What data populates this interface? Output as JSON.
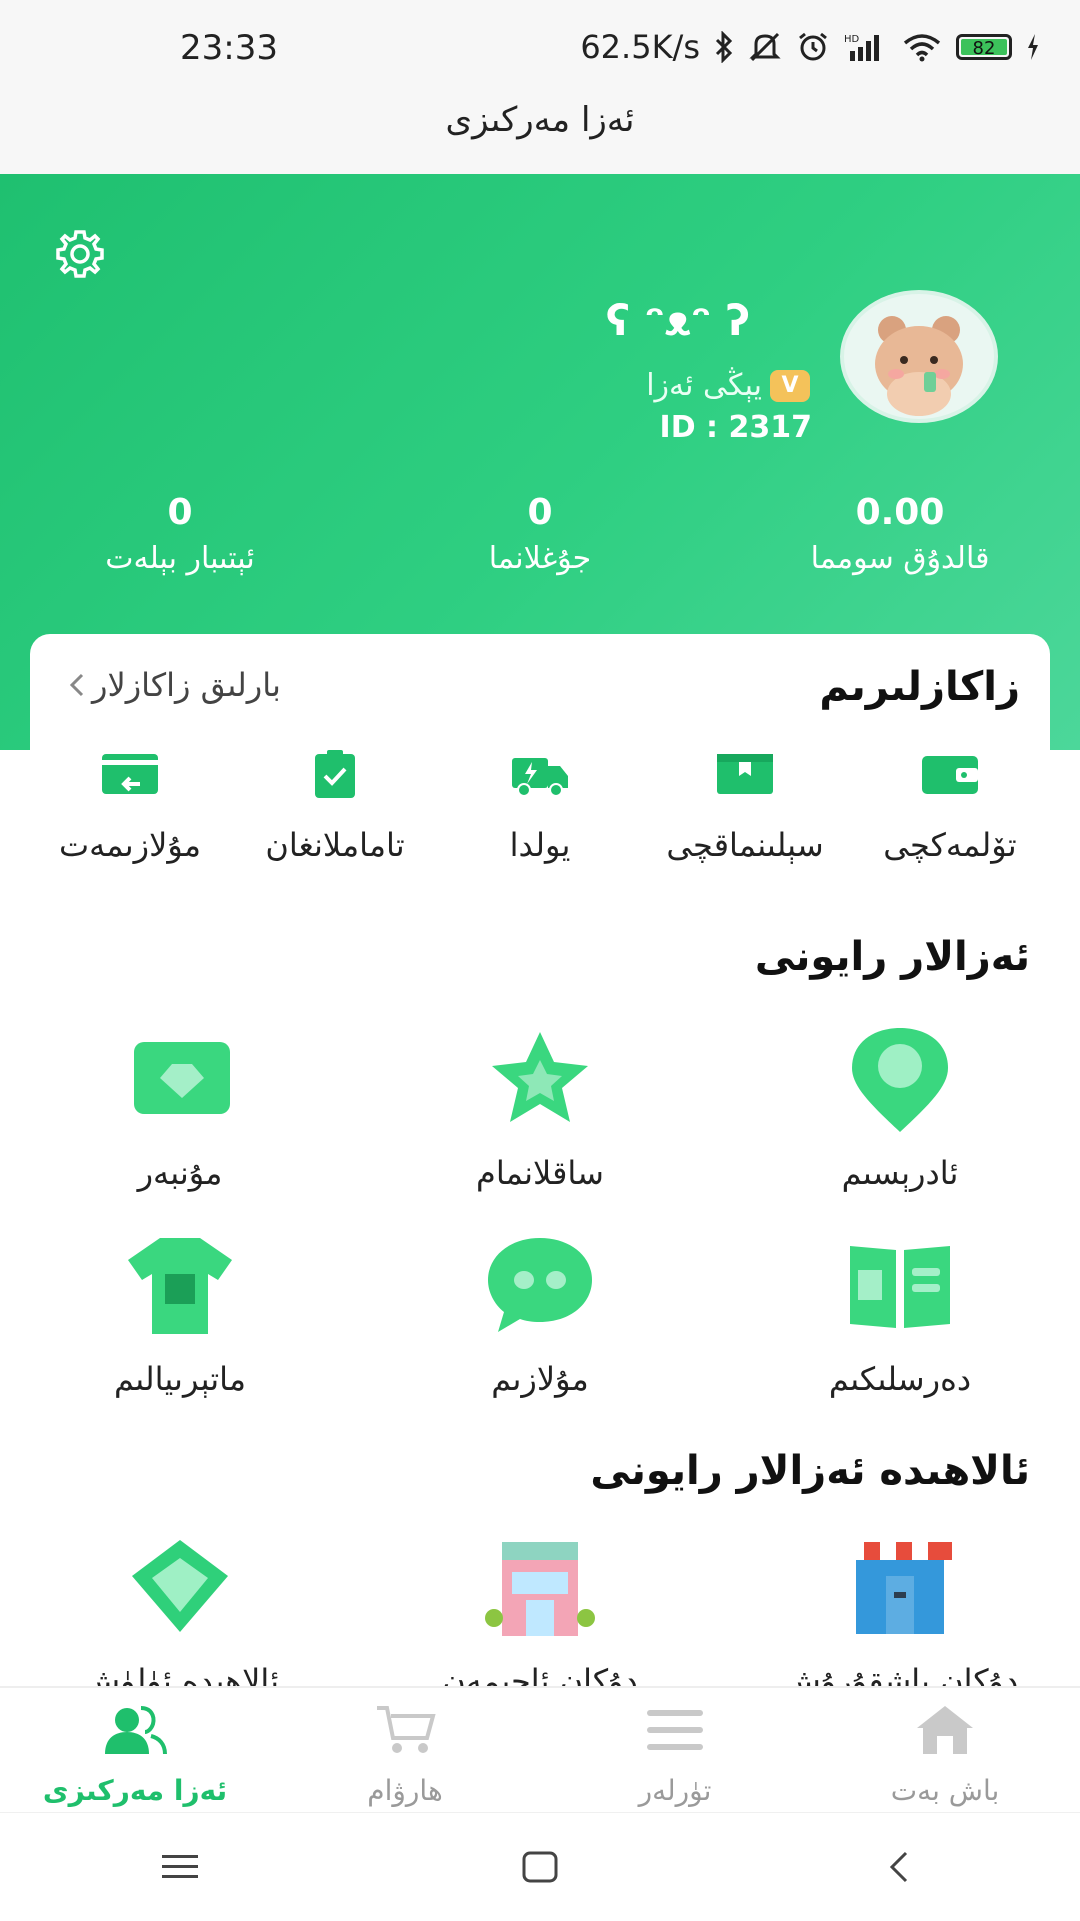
{
  "status_bar": {
    "time": "23:33",
    "network_speed": "62.5K/s",
    "battery": "82",
    "icons": [
      "bluetooth-icon",
      "mute-icon",
      "alarm-icon",
      "hd-signal-icon",
      "wifi-icon",
      "battery-icon",
      "charging-icon"
    ]
  },
  "title_bar": {
    "title": "ئەزا مەركىزى"
  },
  "profile": {
    "nickname": "ʕ ᵔᴥᵔ ʔ",
    "level_label": "يېڭى ئەزا",
    "level_badge": "V",
    "id_text": "ID :  2317"
  },
  "stats": [
    {
      "value": "0.00",
      "label": "قالدۇق سومما"
    },
    {
      "value": "0",
      "label": "جۇغلانما"
    },
    {
      "value": "0",
      "label": "ئېتىبار بېلەت"
    }
  ],
  "orders": {
    "title": "زاكازلىرىم",
    "all_link": "بارلىق زاكازلار",
    "items": [
      {
        "label": "تۆلمەكچى",
        "icon": "wallet-icon"
      },
      {
        "label": "سېلىنماقچى",
        "icon": "box-icon"
      },
      {
        "label": "يولدا",
        "icon": "delivery-truck-icon"
      },
      {
        "label": "تاماملانغان",
        "icon": "clipboard-check-icon"
      },
      {
        "label": "مۇلازىمەت",
        "icon": "return-service-icon"
      }
    ]
  },
  "members_area": {
    "title": "ئەزالار رايونى",
    "items": [
      {
        "label": "ئادرېسىم",
        "icon": "location-pin-icon"
      },
      {
        "label": "ساقلانمام",
        "icon": "star-icon"
      },
      {
        "label": "مۇنبەر",
        "icon": "diamond-card-icon"
      },
      {
        "label": "دەرسلىكىم",
        "icon": "book-icon"
      },
      {
        "label": "مۇلازىم",
        "icon": "chat-bubble-icon"
      },
      {
        "label": "ماتېرىيالىم",
        "icon": "tshirt-icon"
      }
    ]
  },
  "special_area": {
    "title": "ئالاھىدە ئەزالار رايونى",
    "items": [
      {
        "label": "دۇكان باشقۇرۇش",
        "icon": "market-stall-icon"
      },
      {
        "label": "دۇكان ئاچىمەن",
        "icon": "storefront-icon"
      },
      {
        "label": "ئالاھىدە ئۈلۈش",
        "icon": "diamond-icon"
      }
    ]
  },
  "bottom_nav": [
    {
      "label": "باش بەت",
      "icon": "home-icon",
      "active": false
    },
    {
      "label": "تۈرلەر",
      "icon": "list-icon",
      "active": false
    },
    {
      "label": "ھارۋام",
      "icon": "cart-icon",
      "active": false
    },
    {
      "label": "ئەزا مەركىزى",
      "icon": "member-icon",
      "active": true
    }
  ],
  "colors": {
    "accent": "#1fbf6c",
    "header_start": "#1fc070",
    "header_end": "#4cd79a",
    "inactive": "#9a9a9a"
  }
}
